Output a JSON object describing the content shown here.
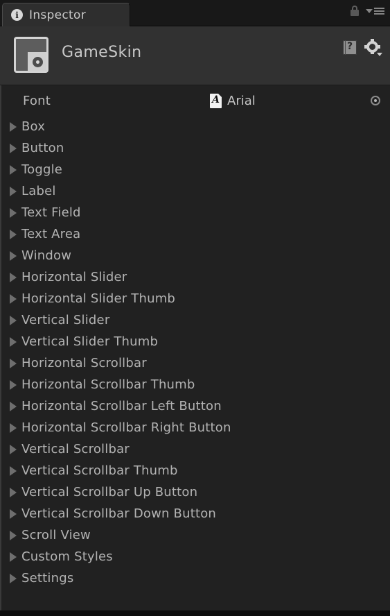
{
  "window": {
    "background_color": "#212121",
    "header_color": "#313131"
  },
  "tabstrip": {
    "tab_label": "Inspector",
    "tab_icon": "info-circle-icon",
    "lock_icon": "lock-icon",
    "menu_icon": "dropdown-menu-icon"
  },
  "asset_header": {
    "title": "GameSkin",
    "asset_icon": "gui-skin-asset-icon",
    "help_icon": "help-book-icon",
    "preset_icon": "gear-preset-icon"
  },
  "font_row": {
    "label": "Font",
    "value": "Arial",
    "value_icon": "font-file-icon",
    "picker_icon": "object-picker-icon"
  },
  "styles": [
    {
      "label": "Box"
    },
    {
      "label": "Button"
    },
    {
      "label": "Toggle"
    },
    {
      "label": "Label"
    },
    {
      "label": "Text Field"
    },
    {
      "label": "Text Area"
    },
    {
      "label": "Window"
    },
    {
      "label": "Horizontal Slider"
    },
    {
      "label": "Horizontal Slider Thumb"
    },
    {
      "label": "Vertical Slider"
    },
    {
      "label": "Vertical Slider Thumb"
    },
    {
      "label": "Horizontal Scrollbar"
    },
    {
      "label": "Horizontal Scrollbar Thumb"
    },
    {
      "label": "Horizontal Scrollbar Left Button"
    },
    {
      "label": "Horizontal Scrollbar Right Button"
    },
    {
      "label": "Vertical Scrollbar"
    },
    {
      "label": "Vertical Scrollbar Thumb"
    },
    {
      "label": "Vertical Scrollbar Up Button"
    },
    {
      "label": "Vertical Scrollbar Down Button"
    },
    {
      "label": "Scroll View"
    },
    {
      "label": "Custom Styles"
    },
    {
      "label": "Settings"
    }
  ]
}
